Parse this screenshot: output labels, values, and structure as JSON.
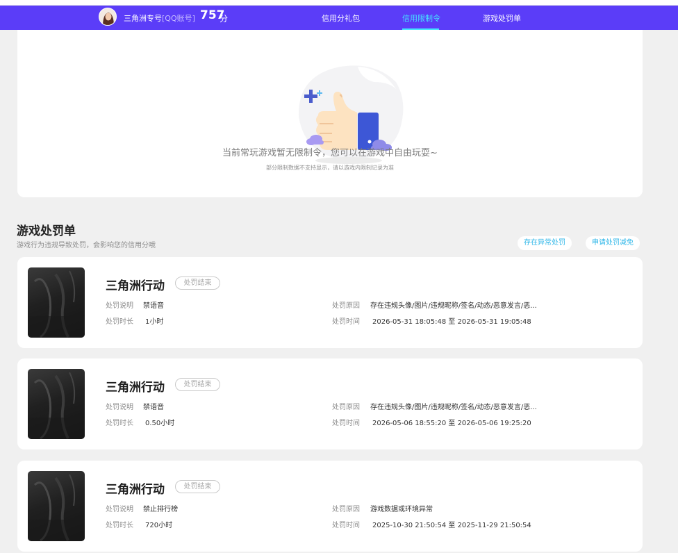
{
  "header": {
    "nickname": "三角洲专号",
    "account_type": "[QQ账号]",
    "score": "757",
    "score_unit": "分",
    "tabs": [
      {
        "label": "信用分礼包",
        "active": false
      },
      {
        "label": "信用限制令",
        "active": true
      },
      {
        "label": "游戏处罚单",
        "active": false
      }
    ]
  },
  "limit": {
    "message": "当前常玩游戏暂无限制令，您可以在游戏中自由玩耍~",
    "sub_note": "部分限制数据不支持显示，请以游戏内限制记录为准"
  },
  "penalty_section": {
    "title": "游戏处罚单",
    "description": "游戏行为违规导致处罚，会影响您的信用分哦",
    "btn_appeal": "存在异常处罚",
    "btn_reduce": "申请处罚减免"
  },
  "labels": {
    "desc": "处罚说明",
    "duration": "处罚时长",
    "reason": "处罚原因",
    "time": "处罚时间"
  },
  "penalties": [
    {
      "game": "三角洲行动",
      "status": "处罚结束",
      "desc": "禁语音",
      "duration": "1小时",
      "reason": "存在违规头像/图片/违规昵称/签名/动态/恶意发言/恶...",
      "time": "2026-05-31 18:05:48 至 2026-05-31 19:05:48"
    },
    {
      "game": "三角洲行动",
      "status": "处罚结束",
      "desc": "禁语音",
      "duration": "0.50小时",
      "reason": "存在违规头像/图片/违规昵称/签名/动态/恶意发言/恶...",
      "time": "2026-05-06 18:55:20 至 2026-05-06 19:25:20"
    },
    {
      "game": "三角洲行动",
      "status": "处罚结束",
      "desc": "禁止排行榜",
      "duration": "720小时",
      "reason": "游戏数据或环境异常",
      "time": "2025-10-30 21:50:54 至 2025-11-29 21:50:54"
    }
  ],
  "colors": {
    "nav_bg": "#5b3df8",
    "nav_active": "#45e5ff",
    "link": "#2cb6e8"
  }
}
